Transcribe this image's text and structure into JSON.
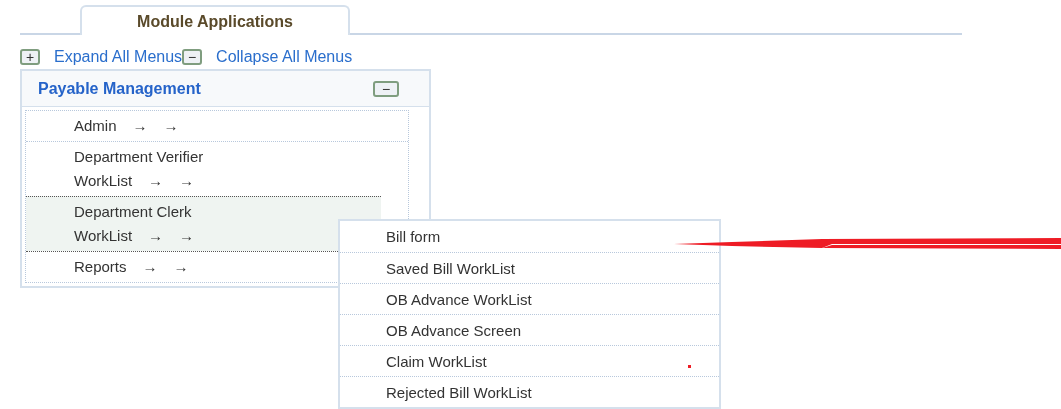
{
  "tabs": [
    {
      "label": "Module Applications",
      "selected": true
    }
  ],
  "toolbar": {
    "expand": {
      "icon": "+",
      "label": "Expand All Menus"
    },
    "collapse": {
      "icon": "−",
      "label": "Collapse All Menus"
    }
  },
  "panel": {
    "title": "Payable Management",
    "expanded": true,
    "toggle": "−",
    "items": [
      {
        "label": "Admin",
        "arrows": [
          "→",
          "→"
        ],
        "selected": false
      },
      {
        "label": "Department Verifier WorkList",
        "arrows": [
          "→",
          "→"
        ],
        "selected": false
      },
      {
        "label": "Department Clerk WorkList",
        "arrows": [
          "→",
          "→"
        ],
        "selected": true
      },
      {
        "label": "Reports",
        "arrows": [
          "→",
          "→"
        ],
        "selected": false
      }
    ]
  },
  "submenu": {
    "items": [
      {
        "label": "Bill form"
      },
      {
        "label": "Saved Bill WorkList"
      },
      {
        "label": "OB Advance WorkList"
      },
      {
        "label": "OB Advance Screen"
      },
      {
        "label": "Claim WorkList"
      },
      {
        "label": "Rejected Bill WorkList"
      }
    ]
  }
}
